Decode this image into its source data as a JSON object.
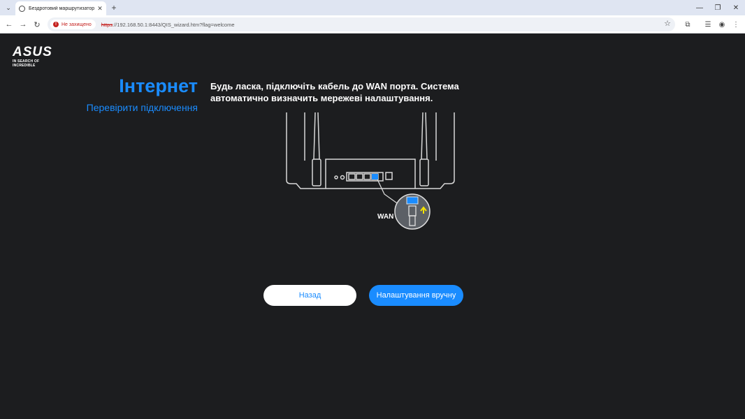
{
  "browser": {
    "tab_title": "Бездротовий маршрутизатор A",
    "security_label": "Не захищено",
    "url_scheme": "https",
    "url_rest": "://192.168.50.1:8443/QIS_wizard.htm?flag=welcome"
  },
  "icons": {
    "tab_menu": "chevron-down-icon",
    "favicon": "globe-icon",
    "tab_close": "close-icon",
    "new_tab": "plus-icon",
    "back": "arrow-left-icon",
    "forward": "arrow-right-icon",
    "reload": "reload-icon",
    "security": "warning-icon",
    "bookmark": "star-icon",
    "extensions": "puzzle-icon",
    "media": "playlist-icon",
    "profile": "profile-icon",
    "menu": "kebab-menu-icon"
  },
  "logo": {
    "brand": "ASUS",
    "tagline": "IN SEARCH OF INCREDIBLE"
  },
  "page": {
    "heading": "Інтернет",
    "check_link": "Перевірити підключення",
    "instruction": "Будь ласка, підключіть кабель до WAN порта. Система автоматично визначить мережеві налаштування.",
    "wan_label": "WAN"
  },
  "buttons": {
    "back": "Назад",
    "manual": "Налаштування вручну"
  },
  "colors": {
    "accent": "#1a8cff",
    "background": "#1c1d1f",
    "arrow": "#f5e400"
  }
}
